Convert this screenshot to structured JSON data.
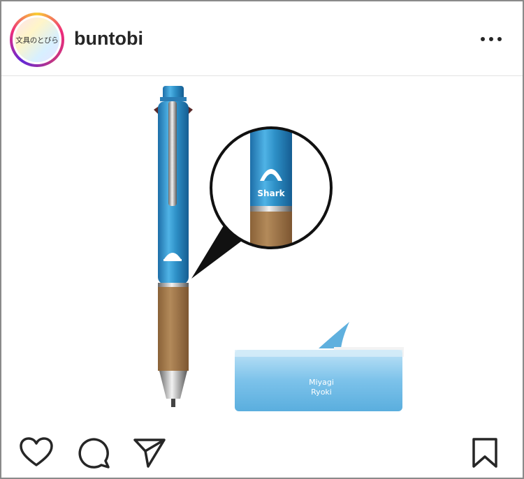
{
  "post": {
    "username": "buntobi",
    "avatar_text": "文具のとびら"
  },
  "photo": {
    "magnifier_label": "Shark",
    "case_text_line1": "Miyagi",
    "case_text_line2": "Ryoki"
  },
  "icons": {
    "more": "more-horizontal-icon",
    "like": "heart-icon",
    "comment": "comment-icon",
    "share": "paper-plane-icon",
    "save": "bookmark-icon"
  },
  "colors": {
    "text": "#262626",
    "pen_blue": "#2d8fc6",
    "wood": "#a57c4f",
    "ring_pink": "#ee2a7b"
  }
}
